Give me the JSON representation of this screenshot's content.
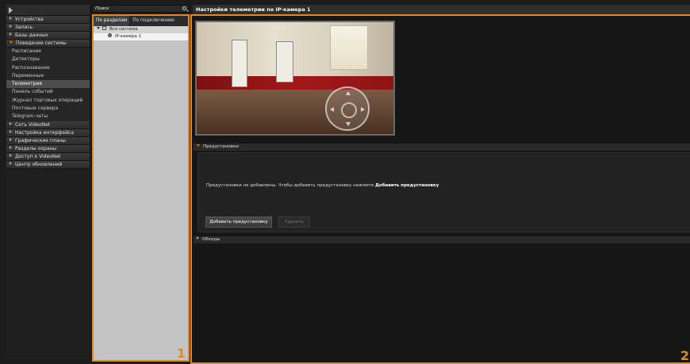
{
  "sidebar": {
    "sections": [
      {
        "label": "Устройства"
      },
      {
        "label": "Запись"
      },
      {
        "label": "Базы данных"
      },
      {
        "label": "Поведение системы",
        "open": true,
        "items": [
          "Расписание",
          "Детекторы",
          "Распознавание",
          "Переменные",
          "Телеметрия",
          "Панель событий",
          "Журнал торговых операций",
          "Почтовые сервера",
          "Telegram-чаты"
        ],
        "active_item": "Телеметрия"
      },
      {
        "label": "Сеть VideoNet"
      },
      {
        "label": "Настройка интерфейса"
      },
      {
        "label": "Графические планы"
      },
      {
        "label": "Разделы охраны"
      },
      {
        "label": "Доступ к VideoNet"
      },
      {
        "label": "Центр обновлений"
      }
    ]
  },
  "panel1": {
    "search_placeholder": "Поиск",
    "tabs": [
      {
        "label": "По разделам",
        "active": true
      },
      {
        "label": "По подключению"
      }
    ],
    "tree": {
      "root": "Вся система",
      "children": [
        "IP-камера 1"
      ]
    },
    "number": "1"
  },
  "panel2": {
    "title": "Настройки телеметрии по IP-камера 1",
    "presets": {
      "header": "Предустановки",
      "message_prefix": "Предустановки не добавлены. Чтобы добавить предустановку нажмите ",
      "message_bold": "Добавить предустановку",
      "add_button": "Добавить предустановку",
      "delete_button": "Удалить"
    },
    "tours_header": "Обходы",
    "number": "2"
  },
  "colors": {
    "accent": "#e08a20",
    "active_arrow": "#e06a1a"
  }
}
